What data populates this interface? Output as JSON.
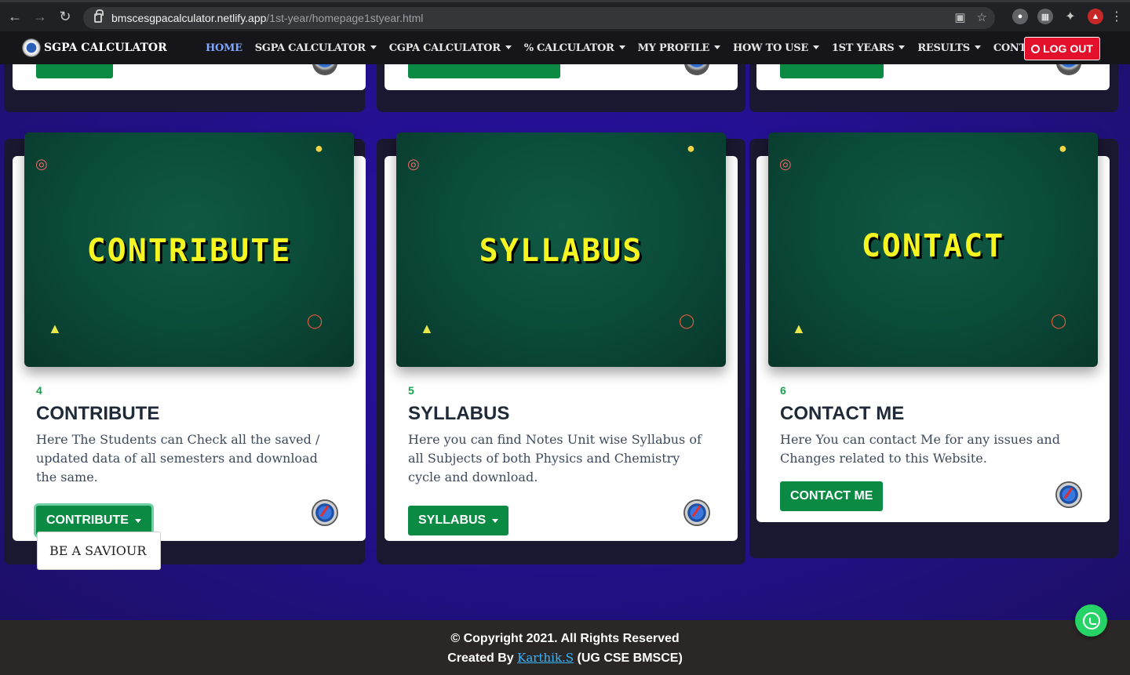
{
  "browser": {
    "url_host": "bmscesgpacalculator.netlify.app",
    "url_path": "/1st-year/homepage1styear.html"
  },
  "site": {
    "brand": "SGPA CALCULATOR",
    "nav": [
      {
        "label": "HOME",
        "active": true,
        "dropdown": false
      },
      {
        "label": "SGPA CALCULATOR",
        "dropdown": true
      },
      {
        "label": "CGPA CALCULATOR",
        "dropdown": true
      },
      {
        "label": "% CALCULATOR",
        "dropdown": true
      },
      {
        "label": "MY PROFILE",
        "dropdown": true
      },
      {
        "label": "HOW TO USE",
        "dropdown": true
      },
      {
        "label": "1ST YEARS",
        "dropdown": true
      },
      {
        "label": "RESULTS",
        "dropdown": true
      },
      {
        "label": "CONTACT",
        "dropdown": false
      }
    ],
    "logout": "LOG OUT"
  },
  "cards": [
    {
      "image_text": "CONTRIBUTE",
      "number": "4",
      "title": "CONTRIBUTE",
      "description": "Here The Students can Check all the saved / updated data of all semesters and download the same.",
      "button": "CONTRIBUTE",
      "dropdown": true
    },
    {
      "image_text": "SYLLABUS",
      "number": "5",
      "title": "SYLLABUS",
      "description": "Here you can find Notes Unit wise Syllabus of all Subjects of both Physics and Chemistry cycle and download.",
      "button": "SYLLABUS",
      "dropdown": true
    },
    {
      "image_text": "CONTACT",
      "number": "6",
      "title": "CONTACT ME",
      "description": "Here You can contact Me for any issues and Changes related to this Website.",
      "button": "CONTACT ME",
      "dropdown": false
    }
  ],
  "open_dropdown": {
    "items": [
      "BE A SAVIOUR"
    ]
  },
  "footer": {
    "copyright": "© Copyright 2021. All Rights Reserved",
    "created_by_prefix": "Created By ",
    "author": "Karthik.S",
    "suffix": " (UG CSE BMSCE)"
  },
  "colors": {
    "accent_green": "#0b8a44",
    "logout_red": "#e3102b",
    "nav_active": "#7fa7ff",
    "banner_text": "#f5f522"
  }
}
